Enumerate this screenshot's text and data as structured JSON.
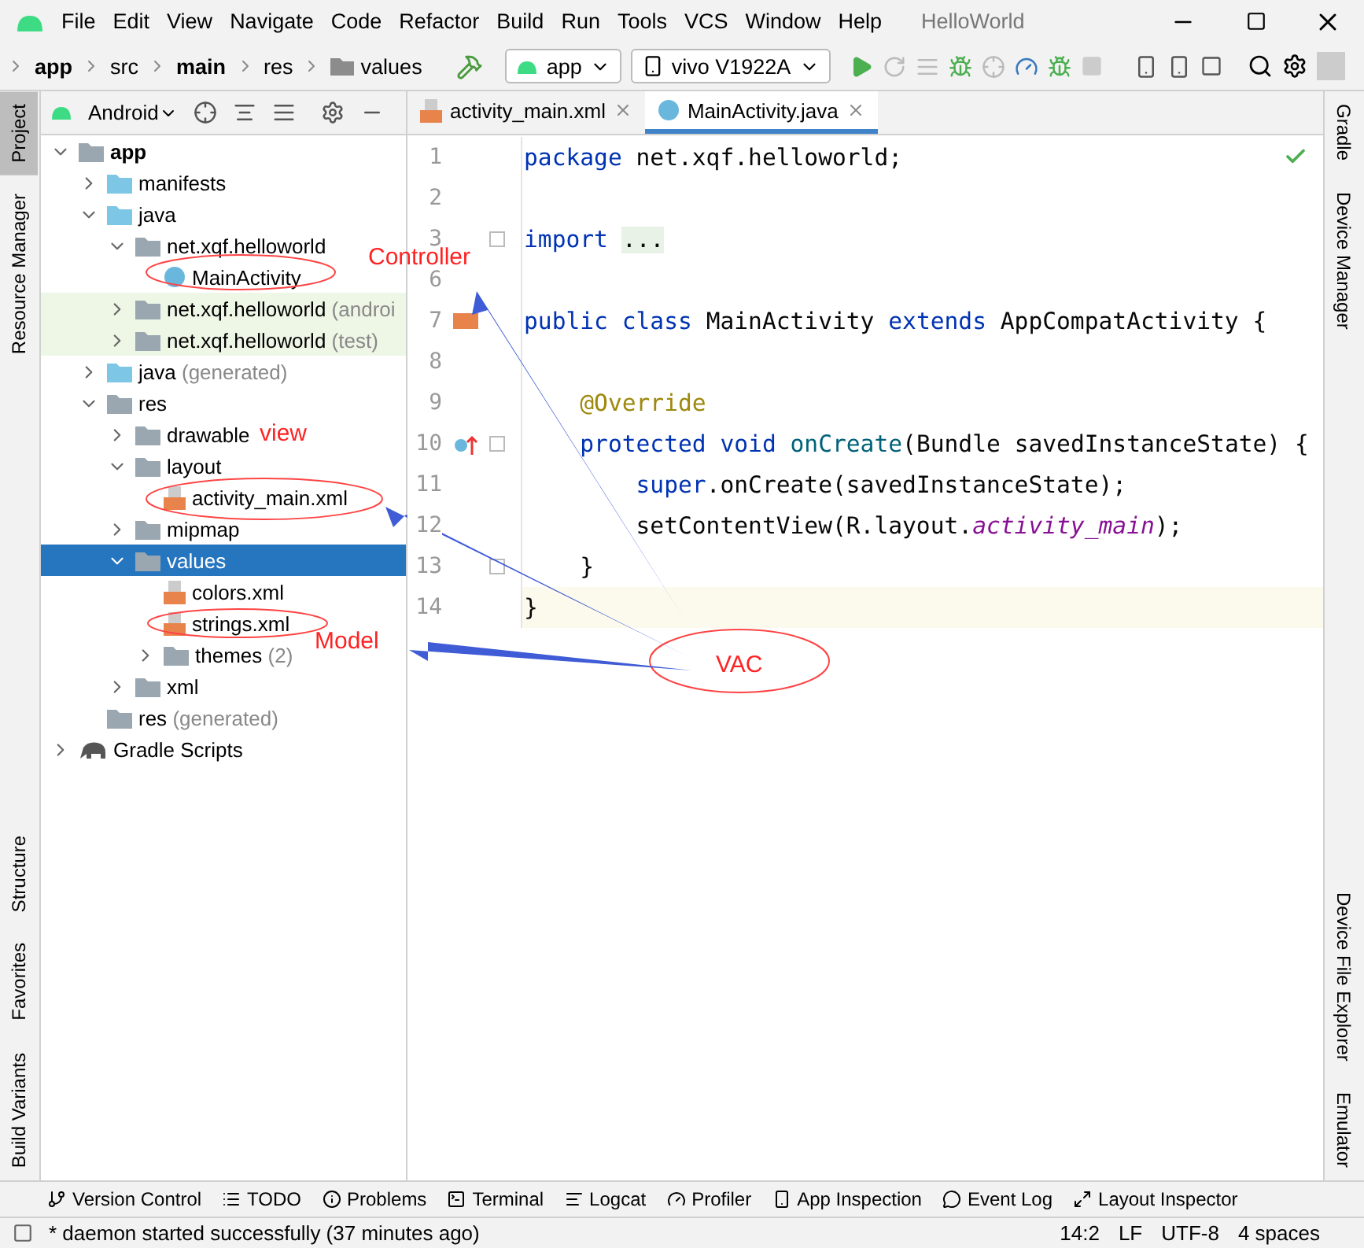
{
  "window": {
    "title": "HelloWorld"
  },
  "menu": [
    "File",
    "Edit",
    "View",
    "Navigate",
    "Code",
    "Refactor",
    "Build",
    "Run",
    "Tools",
    "VCS",
    "Window",
    "Help"
  ],
  "breadcrumb": [
    {
      "label": "app",
      "bold": true,
      "folder": false
    },
    {
      "label": "src",
      "bold": false,
      "folder": false
    },
    {
      "label": "main",
      "bold": true,
      "folder": false
    },
    {
      "label": "res",
      "bold": false,
      "folder": false
    },
    {
      "label": "values",
      "bold": false,
      "folder": true
    }
  ],
  "run_config": "app",
  "device": "vivo V1922A",
  "left_stripe": {
    "top": [
      {
        "label": "Project",
        "selected": true
      },
      {
        "label": "Resource Manager",
        "selected": false
      }
    ],
    "bottom": [
      {
        "label": "Structure",
        "selected": false
      },
      {
        "label": "Favorites",
        "selected": false
      },
      {
        "label": "Build Variants",
        "selected": false
      }
    ]
  },
  "right_stripe": {
    "top": [
      "Gradle",
      "Device Manager"
    ],
    "bottom": [
      "Device File Explorer",
      "Emulator"
    ]
  },
  "project_view": "Android",
  "tree": [
    {
      "label": "app",
      "kind": "module",
      "bold": true,
      "expanded": true,
      "selected": false,
      "highlighted": false,
      "children": [
        {
          "label": "manifests",
          "kind": "folder",
          "expanded": false,
          "selected": false,
          "highlighted": false
        },
        {
          "label": "java",
          "kind": "folder",
          "expanded": true,
          "selected": false,
          "highlighted": false,
          "children": [
            {
              "label": "net.xqf.helloworld",
              "kind": "package",
              "expanded": true,
              "selected": false,
              "highlighted": false,
              "children": [
                {
                  "label": "MainActivity",
                  "kind": "class",
                  "selected": false,
                  "highlighted": false
                }
              ]
            },
            {
              "label": "net.xqf.helloworld",
              "hint": "(androi",
              "kind": "package",
              "expanded": false,
              "selected": false,
              "highlighted": true
            },
            {
              "label": "net.xqf.helloworld",
              "hint": "(test)",
              "kind": "package",
              "expanded": false,
              "selected": false,
              "highlighted": true
            }
          ]
        },
        {
          "label": "java",
          "hint": "(generated)",
          "kind": "genfolder",
          "expanded": false,
          "selected": false,
          "highlighted": false
        },
        {
          "label": "res",
          "kind": "resfolder",
          "expanded": true,
          "selected": false,
          "highlighted": false,
          "children": [
            {
              "label": "drawable",
              "kind": "package",
              "expanded": false,
              "selected": false,
              "highlighted": false
            },
            {
              "label": "layout",
              "kind": "package",
              "expanded": true,
              "selected": false,
              "highlighted": false,
              "children": [
                {
                  "label": "activity_main.xml",
                  "kind": "xml",
                  "selected": false,
                  "highlighted": false
                }
              ]
            },
            {
              "label": "mipmap",
              "kind": "package",
              "expanded": false,
              "selected": false,
              "highlighted": false
            },
            {
              "label": "values",
              "kind": "package",
              "expanded": true,
              "selected": true,
              "highlighted": false,
              "children": [
                {
                  "label": "colors.xml",
                  "kind": "xml",
                  "selected": false,
                  "highlighted": false
                },
                {
                  "label": "strings.xml",
                  "kind": "xml",
                  "selected": false,
                  "highlighted": false
                },
                {
                  "label": "themes",
                  "hint": "(2)",
                  "kind": "package",
                  "expanded": false,
                  "selected": false,
                  "highlighted": false
                }
              ]
            },
            {
              "label": "xml",
              "kind": "package",
              "expanded": false,
              "selected": false,
              "highlighted": false
            }
          ]
        },
        {
          "label": "res",
          "hint": "(generated)",
          "kind": "resfolder",
          "selected": false,
          "highlighted": false
        }
      ]
    },
    {
      "label": "Gradle Scripts",
      "kind": "gradle",
      "expanded": false,
      "selected": false,
      "highlighted": false
    }
  ],
  "editor_tabs": [
    {
      "label": "activity_main.xml",
      "kind": "xml",
      "selected": false
    },
    {
      "label": "MainActivity.java",
      "kind": "class",
      "selected": true
    }
  ],
  "code": [
    {
      "number": "1",
      "kind": "plain",
      "current": false,
      "fold": false,
      "tokens": [
        {
          "kind": "keyword",
          "text": "package"
        },
        {
          "kind": "plain",
          "text": " net.xqf.helloworld;"
        }
      ]
    },
    {
      "number": "2",
      "kind": "plain",
      "current": false,
      "fold": false
    },
    {
      "number": "3",
      "kind": "plain",
      "current": false,
      "fold": true,
      "tokens": [
        {
          "kind": "keyword",
          "text": "import"
        },
        {
          "kind": "folded",
          "text": "..."
        }
      ]
    },
    {
      "number": "6",
      "kind": "plain",
      "current": false,
      "fold": false
    },
    {
      "number": "7",
      "kind": "layout",
      "current": false,
      "fold": false,
      "tokens": [
        {
          "kind": "keyword",
          "text": "public class"
        },
        {
          "kind": "plain",
          "text": " MainActivity "
        },
        {
          "kind": "keyword",
          "text": "extends"
        },
        {
          "kind": "plain",
          "text": " AppCompatActivity {"
        }
      ]
    },
    {
      "number": "8",
      "kind": "plain",
      "current": false,
      "fold": false
    },
    {
      "number": "9",
      "kind": "plain",
      "current": false,
      "fold": false,
      "tokens": [
        {
          "kind": "annotation",
          "text": "    @Override"
        }
      ]
    },
    {
      "number": "10",
      "kind": "override",
      "current": false,
      "fold": true,
      "tokens": [
        {
          "kind": "keyword",
          "text": "    protected void"
        },
        {
          "kind": "method",
          "text": " onCreate"
        },
        {
          "kind": "plain",
          "text": "(Bundle savedInstanceState) {"
        }
      ]
    },
    {
      "number": "11",
      "kind": "plain",
      "current": false,
      "fold": false,
      "tokens": [
        {
          "kind": "keyword",
          "text": "        super"
        },
        {
          "kind": "plain",
          "text": ".onCreate(savedInstanceState);"
        }
      ]
    },
    {
      "number": "12",
      "kind": "plain",
      "current": false,
      "fold": false,
      "tokens": [
        {
          "kind": "plain",
          "text": "        setContentView(R.layout."
        },
        {
          "kind": "field",
          "text": "activity_main"
        },
        {
          "kind": "plain",
          "text": ");"
        }
      ]
    },
    {
      "number": "13",
      "kind": "plain",
      "current": false,
      "fold": true,
      "tokens": [
        {
          "kind": "plain",
          "text": "    }"
        }
      ]
    },
    {
      "number": "14",
      "kind": "plain",
      "current": true,
      "fold": false,
      "tokens": [
        {
          "kind": "plain",
          "text": "}"
        }
      ]
    }
  ],
  "annotations": [
    {
      "label": "Controller"
    },
    {
      "label": "view"
    },
    {
      "label": "Model"
    },
    {
      "label": "VAC"
    }
  ],
  "tool_windows": [
    "Version Control",
    "TODO",
    "Problems",
    "Terminal",
    "Logcat",
    "Profiler",
    "App Inspection",
    "Event Log",
    "Layout Inspector"
  ],
  "status_bar": {
    "message": "* daemon started successfully (37 minutes ago)",
    "items": [
      "14:2",
      "LF",
      "UTF-8",
      "4 spaces"
    ]
  }
}
